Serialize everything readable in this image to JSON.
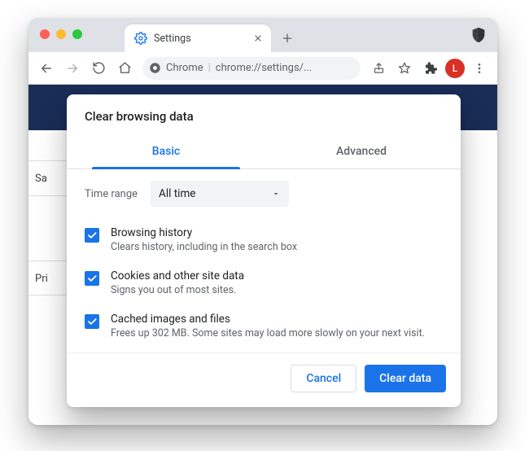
{
  "window": {
    "tab_title": "Settings",
    "omnibox_label": "Chrome",
    "omnibox_url": "chrome://settings/...",
    "avatar_initial": "L"
  },
  "page_background": {
    "left_label_1": "Sa",
    "left_label_2": "Pri"
  },
  "dialog": {
    "title": "Clear browsing data",
    "tabs": {
      "basic": "Basic",
      "advanced": "Advanced",
      "active": "basic"
    },
    "time_range_label": "Time range",
    "time_range_value": "All time",
    "options": [
      {
        "checked": true,
        "title": "Browsing history",
        "desc": "Clears history, including in the search box"
      },
      {
        "checked": true,
        "title": "Cookies and other site data",
        "desc": "Signs you out of most sites."
      },
      {
        "checked": true,
        "title": "Cached images and files",
        "desc": "Frees up 302 MB. Some sites may load more slowly on your next visit."
      }
    ],
    "cancel_label": "Cancel",
    "confirm_label": "Clear data"
  },
  "icons": {
    "gear": "gear-icon",
    "close": "close-icon",
    "plus": "plus-icon",
    "shield": "shield-icon",
    "back": "back-icon",
    "forward": "forward-icon",
    "reload": "reload-icon",
    "home": "home-icon",
    "chrome": "chrome-icon",
    "share": "share-icon",
    "star": "star-icon",
    "ext": "extensions-icon",
    "menu": "menu-icon",
    "chevron": "chevron-down-icon",
    "check": "check-icon"
  },
  "colors": {
    "accent": "#1a73e8",
    "header_band": "#1a2d57",
    "avatar_bg": "#d93025"
  }
}
